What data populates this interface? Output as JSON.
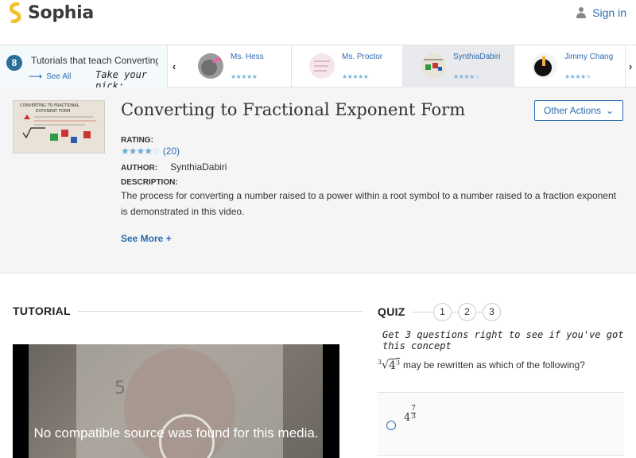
{
  "header": {
    "brand": "Sophia",
    "signin_label": "Sign in",
    "brand_color": "#f6c12e",
    "link_color": "#2b6cb0"
  },
  "strip": {
    "count": "8",
    "title": "Tutorials that teach Converting",
    "see_all": "See All",
    "pick_prompt": "Take your pick:",
    "tutors": [
      {
        "name": "Ms. Hess",
        "stars": 5,
        "active": false
      },
      {
        "name": "Ms. Proctor",
        "stars": 5,
        "active": false
      },
      {
        "name": "SynthiaDabiri",
        "stars": 4,
        "active": true
      },
      {
        "name": "Jimmy Chang",
        "stars": 4,
        "active": false
      }
    ],
    "prev_icon": "chevron-left-icon",
    "next_icon": "chevron-right-icon"
  },
  "lesson": {
    "title": "Converting to Fractional Exponent Form",
    "other_actions": "Other Actions",
    "rating_label": "RATING:",
    "rating_stars": 4,
    "rating_count": "(20)",
    "author_label": "AUTHOR:",
    "author": "SynthiaDabiri",
    "description_label": "DESCRIPTION:",
    "description": "The process for converting a number raised to a power within a root symbol to a number raised to a fraction exponent is demonstrated in this video.",
    "see_more": "See More +"
  },
  "tutorial": {
    "heading": "TUTORIAL",
    "video_message": "No compatible source was found for this media."
  },
  "quiz": {
    "heading": "QUIZ",
    "steps": [
      "1",
      "2",
      "3"
    ],
    "tagline": "Get 3 questions right to see if you've got this concept",
    "question_index": "3",
    "question_base": "4",
    "question_exp": "3",
    "question_text": "may be rewritten as which of the following?",
    "answer_base": "4",
    "answer_num": "7",
    "answer_den": "3"
  }
}
